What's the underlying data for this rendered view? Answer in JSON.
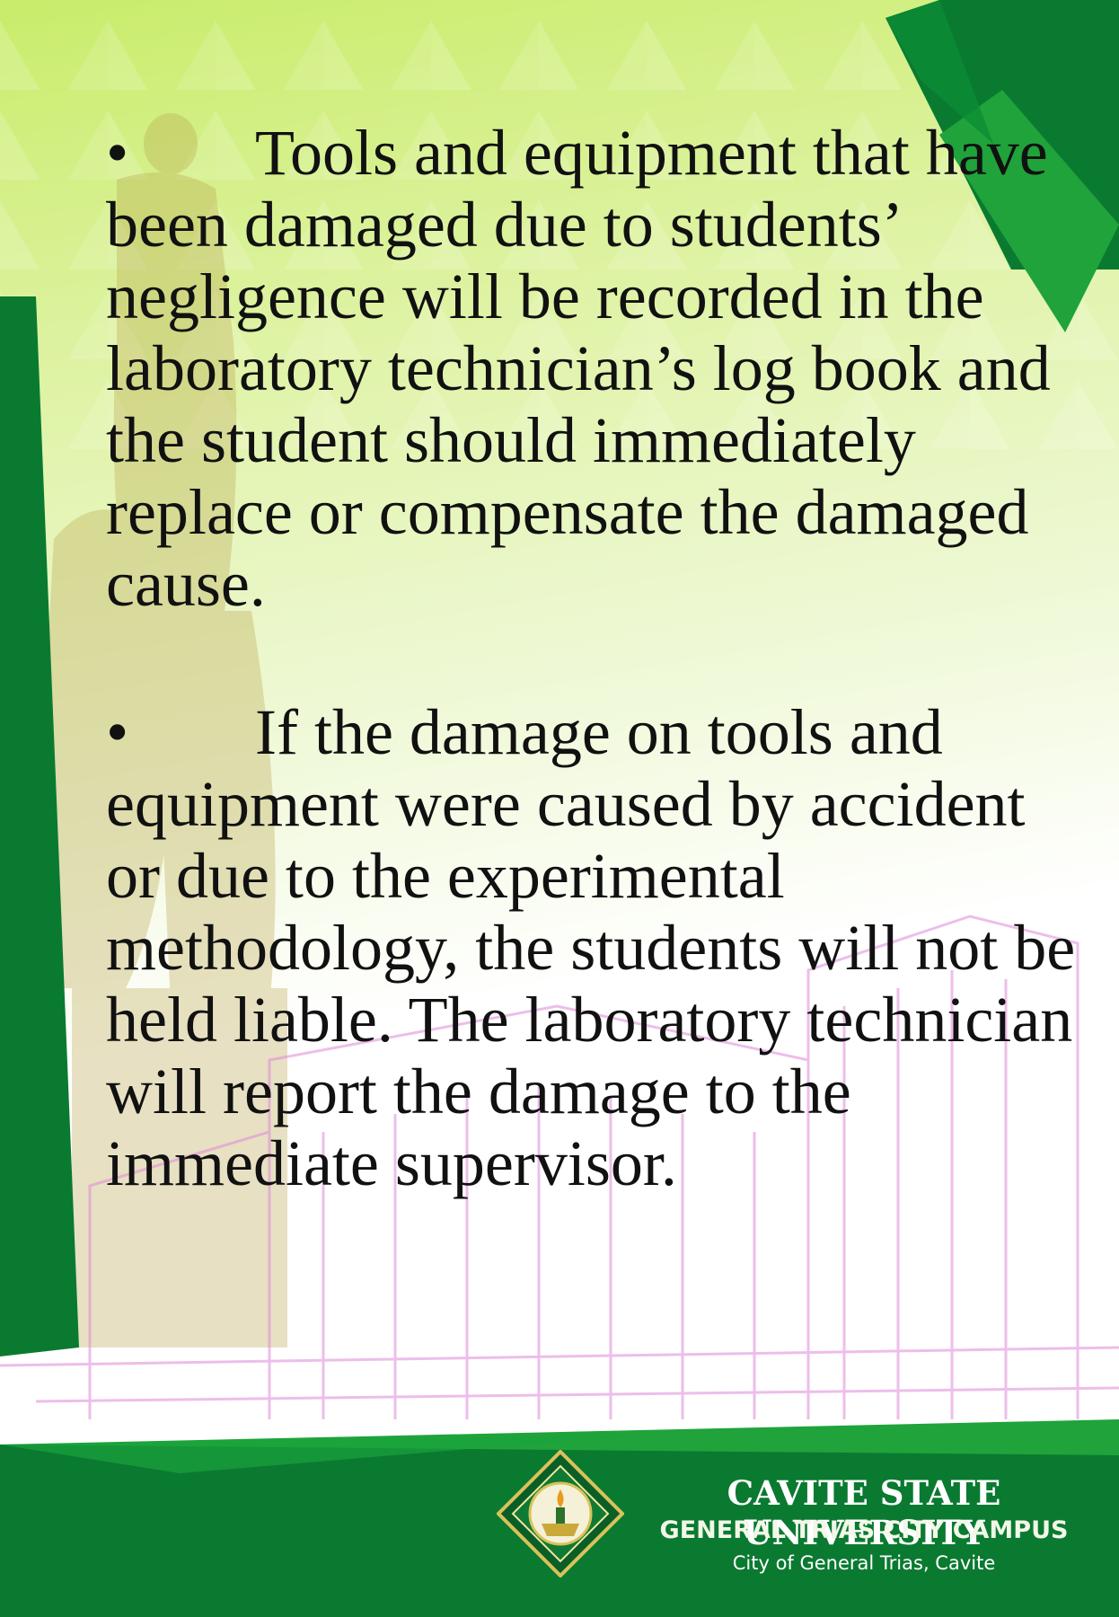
{
  "content": {
    "bullets": [
      {
        "marker": "•",
        "text": "Tools and equipment that have been damaged due to students’ negligence will be recorded in the laboratory technician’s log book and the student should immediately replace or compensate the damaged cause."
      },
      {
        "marker": "•",
        "text": "If the damage on tools and equipment were caused by accident or due to the experimental methodology, the students will not be held liable. The laboratory technician will report the damage to the immediate supervisor."
      }
    ]
  },
  "footer": {
    "university": "CAVITE STATE UNIVERSITY",
    "campus": "GENERAL TRIAS CITY CAMPUS",
    "city": "City of General Trias, Cavite"
  },
  "colors": {
    "dark_green": "#0a7a31",
    "bright_green": "#1fa33a",
    "lime": "#c9ec6a",
    "text": "#111111"
  }
}
